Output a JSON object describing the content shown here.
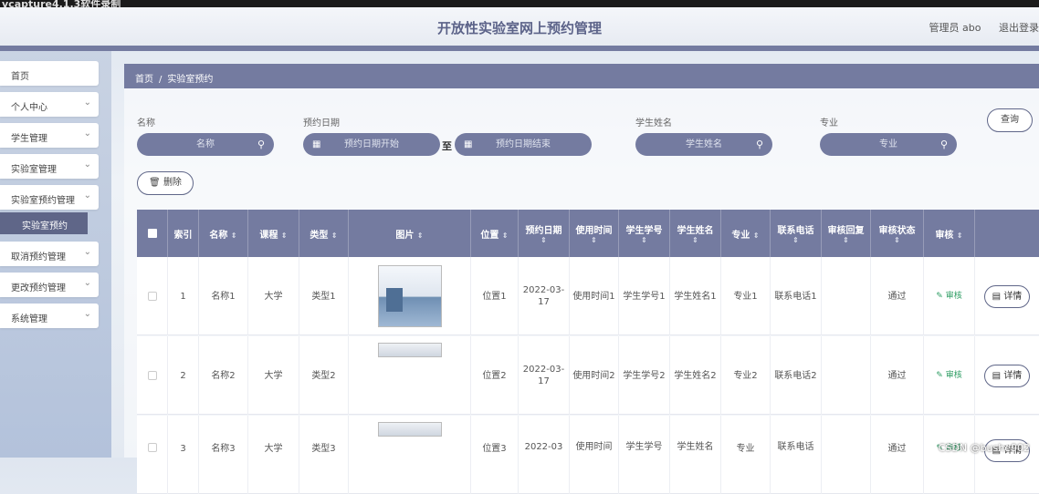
{
  "window_title": "vcapture4.1.3软件录制",
  "header": {
    "title": "开放性实验室网上预约管理",
    "user": "管理员 abo",
    "logout": "退出登录"
  },
  "sidebar": {
    "items": [
      {
        "label": "首页",
        "chevron": false
      },
      {
        "label": "个人中心",
        "chevron": true
      },
      {
        "label": "学生管理",
        "chevron": true
      },
      {
        "label": "实验室管理",
        "chevron": true
      },
      {
        "label": "实验室预约管理",
        "chevron": true
      },
      {
        "label": "取消预约管理",
        "chevron": true
      },
      {
        "label": "更改预约管理",
        "chevron": true
      },
      {
        "label": "系统管理",
        "chevron": true
      }
    ],
    "active_sub": "实验室预约"
  },
  "breadcrumb": {
    "home": "首页",
    "sep": "/",
    "current": "实验室预约"
  },
  "filters": {
    "name_label": "名称",
    "name_placeholder": "名称",
    "date_label": "预约日期",
    "date_start_placeholder": "预约日期开始",
    "date_to": "至",
    "date_end_placeholder": "预约日期结束",
    "student_label": "学生姓名",
    "student_placeholder": "学生姓名",
    "major_label": "专业",
    "major_placeholder": "专业",
    "search_button": "查询"
  },
  "delete_button": "删除",
  "table": {
    "headers": [
      "",
      "索引",
      "名称",
      "课程",
      "类型",
      "图片",
      "位置",
      "预约日期",
      "使用时间",
      "学生学号",
      "学生姓名",
      "专业",
      "联系电话",
      "审核回复",
      "审核状态",
      "审核",
      ""
    ],
    "rows": [
      {
        "index": "1",
        "name": "名称1",
        "course": "大学",
        "type": "类型1",
        "location": "位置1",
        "date": "2022-03-17",
        "use_time": "使用时间1",
        "student_no": "学生学号1",
        "student_name": "学生姓名1",
        "major": "专业1",
        "phone": "联系电话1",
        "reply": "",
        "status": "通过",
        "audit": "审核",
        "detail": "详情"
      },
      {
        "index": "2",
        "name": "名称2",
        "course": "大学",
        "type": "类型2",
        "location": "位置2",
        "date": "2022-03-17",
        "use_time": "使用时间2",
        "student_no": "学生学号2",
        "student_name": "学生姓名2",
        "major": "专业2",
        "phone": "联系电话2",
        "reply": "",
        "status": "通过",
        "audit": "审核",
        "detail": "详情"
      },
      {
        "index": "3",
        "name": "名称3",
        "course": "大学",
        "type": "类型3",
        "location": "位置3",
        "date": "2022-03",
        "use_time": "使用时间",
        "student_no": "学生学号",
        "student_name": "学生姓名",
        "major": "专业",
        "phone": "联系电话",
        "reply": "",
        "status": "通过",
        "audit": "审核",
        "detail": "详情"
      }
    ]
  },
  "watermark": "CSDN @bushe902",
  "colors": {
    "accent": "#747ba0",
    "sidebar_active": "#5f6688",
    "audit": "#2f9d64"
  }
}
